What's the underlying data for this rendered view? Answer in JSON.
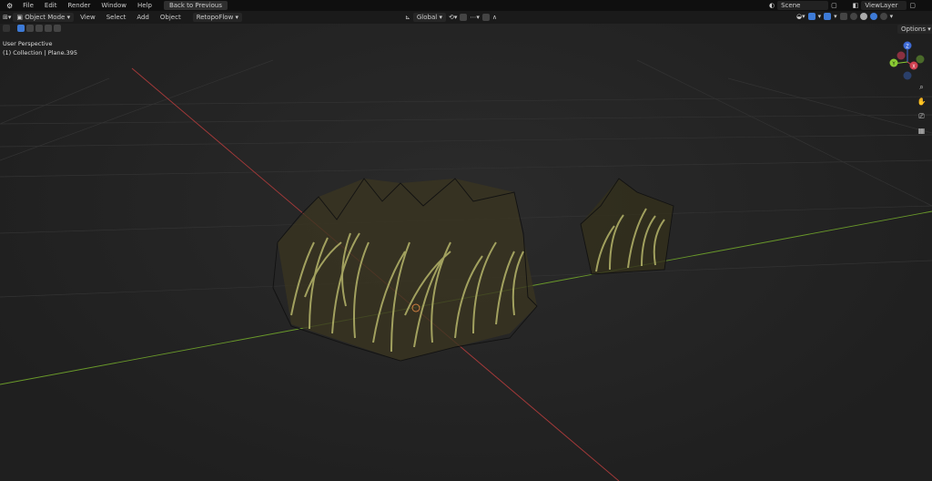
{
  "topbar": {
    "menus": [
      "File",
      "Edit",
      "Render",
      "Window",
      "Help"
    ],
    "back_button": "Back to Previous",
    "scene": "Scene",
    "view_layer": "ViewLayer"
  },
  "header": {
    "mode": "Object Mode",
    "menus": [
      "View",
      "Select",
      "Add",
      "Object"
    ],
    "addon": "RetopoFlow",
    "orientation": "Global",
    "options": "Options"
  },
  "viewport": {
    "perspective": "User Perspective",
    "collection": "(1) Collection | Plane.395"
  },
  "gizmo": {
    "z": "Z",
    "y": "Y",
    "x": "X"
  },
  "colors": {
    "x_axis": "#a83a3a",
    "y_axis": "#6a9a2a",
    "grass": "#b5b56a",
    "accent": "#3d7ad6"
  }
}
